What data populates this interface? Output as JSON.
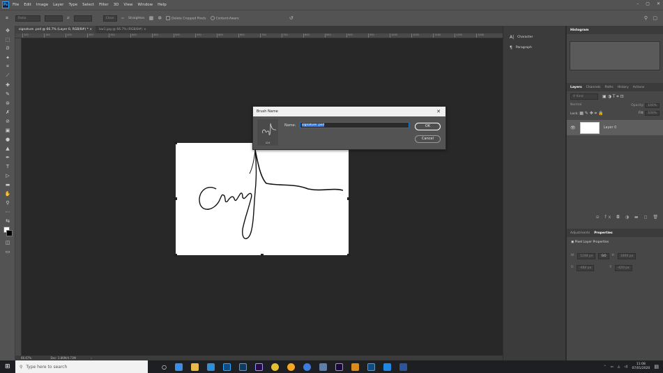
{
  "menubar": {
    "logo": "Ps",
    "items": [
      "File",
      "Edit",
      "Image",
      "Layer",
      "Type",
      "Select",
      "Filter",
      "3D",
      "View",
      "Window",
      "Help"
    ],
    "window_controls": [
      "–",
      "▢",
      "✕"
    ]
  },
  "options_bar": {
    "ratio": "Ratio",
    "clear": "Clear",
    "straighten": "Straighten",
    "delete_cropped": "Delete Cropped Pixels",
    "content_aware": "Content-Aware"
  },
  "tabs": [
    {
      "label": "signature .psd @ 66.7% (Layer 0, RGB/8#) *",
      "close": "×"
    },
    {
      "label": "bw1.jpg @ 66.7% (RGB/8#)",
      "close": "×"
    }
  ],
  "ruler_ticks": [
    "100",
    "150",
    "200",
    "300",
    "350",
    "400",
    "450",
    "500",
    "550",
    "600",
    "650",
    "700",
    "750",
    "800",
    "850",
    "900",
    "950",
    "1000",
    "1050",
    "1100",
    "1150",
    "1200"
  ],
  "status": {
    "zoom": "66.67%",
    "doc": "Doc: 3.86M/4.73M"
  },
  "side_strip": [
    {
      "icon": "A|",
      "label": "Character"
    },
    {
      "icon": "¶",
      "label": "Paragraph"
    }
  ],
  "right_panel": {
    "histogram_tab": "Histogram",
    "layer_tabs": [
      "Layers",
      "Channels",
      "Paths",
      "History",
      "Actions"
    ],
    "kind_label": "Kind",
    "blend_mode": "Normal",
    "opacity_label": "Opacity:",
    "opacity_value": "100%",
    "lock_label": "Lock:",
    "fill_label": "Fill:",
    "fill_value": "100%",
    "layer_name": "Layer 0",
    "props_tabs": [
      "Adjustments",
      "Properties"
    ],
    "props_title": "Pixel Layer Properties",
    "w_label": "W:",
    "w_value": "1248 px",
    "link_icon": "GO",
    "h_label": "H:",
    "h_value": "1800 px",
    "x_label": "X:",
    "x_value": "-484 px",
    "y_label": "Y:",
    "y_value": "-420 px"
  },
  "dialog": {
    "title": "Brush Name",
    "close": "✕",
    "thumb_caption": "424",
    "name_label": "Name:",
    "name_value": "signature .psd",
    "ok_label": "OK",
    "cancel_label": "Cancel"
  },
  "taskbar": {
    "search_placeholder": "Type here to search",
    "time": "11:08",
    "date": "07/01/2020"
  },
  "colors": {
    "accent": "#31a8ff",
    "chrome": "#535353",
    "canvas_bg": "#282828"
  }
}
